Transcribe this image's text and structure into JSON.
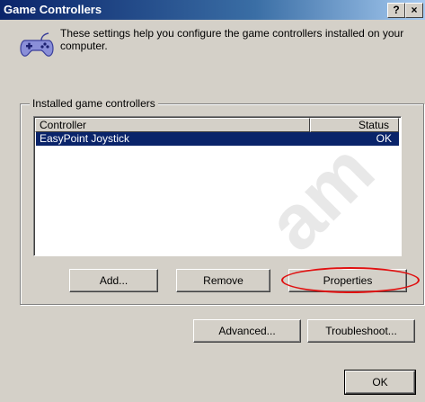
{
  "window": {
    "title": "Game Controllers",
    "help_button": "?",
    "close_button": "×"
  },
  "intro": {
    "text": "These settings help you configure the game controllers installed on your computer.",
    "icon": "gamepad-icon"
  },
  "installed_group": {
    "label": "Installed game controllers",
    "columns": {
      "controller": "Controller",
      "status": "Status"
    },
    "rows": [
      {
        "controller": "EasyPoint Joystick",
        "status": "OK",
        "selected": true
      }
    ]
  },
  "buttons": {
    "add": "Add...",
    "remove": "Remove",
    "properties": "Properties",
    "advanced": "Advanced...",
    "troubleshoot": "Troubleshoot...",
    "ok": "OK"
  },
  "watermark": {
    "text": "am"
  },
  "colors": {
    "title_bar": "#0a246a",
    "selection": "#0a246a",
    "annotation_ellipse": "#e01010",
    "face": "#d4d0c8"
  }
}
